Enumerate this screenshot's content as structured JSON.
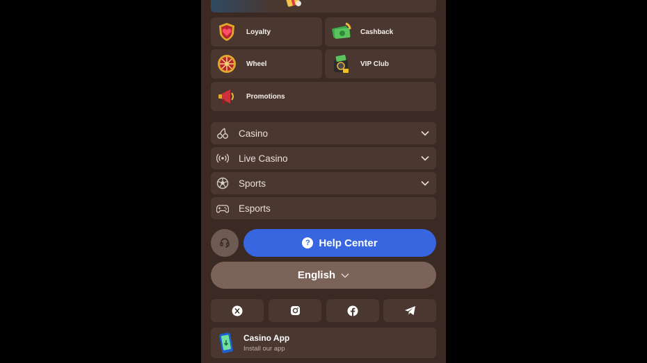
{
  "menu": {
    "tiles": [
      {
        "label": "Loyalty",
        "icon": "loyalty-shield-heart-icon"
      },
      {
        "label": "Cashback",
        "icon": "cashback-money-icon"
      },
      {
        "label": "Wheel",
        "icon": "fortune-wheel-icon"
      },
      {
        "label": "VIP Club",
        "icon": "vip-safe-icon"
      },
      {
        "label": "Promotions",
        "icon": "promotions-megaphone-icon"
      }
    ],
    "nav": [
      {
        "label": "Casino",
        "icon": "cherries-icon",
        "expandable": true
      },
      {
        "label": "Live Casino",
        "icon": "broadcast-icon",
        "expandable": true
      },
      {
        "label": "Sports",
        "icon": "soccer-ball-icon",
        "expandable": true
      },
      {
        "label": "Esports",
        "icon": "gamepad-icon",
        "expandable": false
      }
    ]
  },
  "support": {
    "help_label": "Help Center",
    "help_icon": "?",
    "colors": {
      "help": "#3766e0",
      "support": "#6d5a52"
    }
  },
  "language": {
    "selected": "English"
  },
  "social": [
    "x-icon",
    "instagram-icon",
    "facebook-icon",
    "telegram-icon"
  ],
  "app": {
    "title": "Casino App",
    "subtitle": "Install our app"
  },
  "colors": {
    "panel": "#3a2a23",
    "card": "#4a372f",
    "accent": "#3766e0"
  }
}
